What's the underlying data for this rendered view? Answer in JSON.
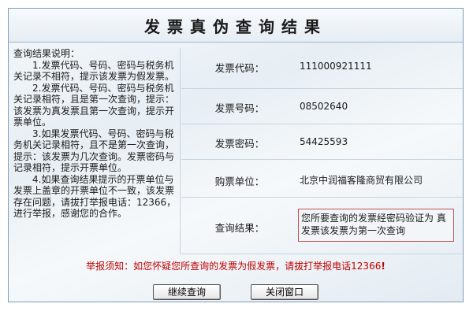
{
  "title": "发票真伪查询结果",
  "notes": {
    "heading": "查询结果说明：",
    "items": [
      "1.发票代码、号码、密码与税务机关记录不相符，提示该发票为假发票。",
      "2.发票代码、号码、密码与税务机关记录相符，且是第一次查询，提示：该发票为真发票且第一次查询，提示开票单位。",
      "3.如果发票代码、号码、密码与税务机关记录相符，且不是第一次查询，提示：该发票为几次查询。发票密码与记录相符，提示开票单位。",
      "4.如果查询结果提示的开票单位与发票上盖章的开票单位不一致，该发票存在问题，请拔打举报电话：12366，进行举报，感谢您的合作。"
    ]
  },
  "fields": {
    "code": {
      "label": "发票代码：",
      "value": "111000921111"
    },
    "number": {
      "label": "发票号码：",
      "value": "08502640"
    },
    "password": {
      "label": "发票密码：",
      "value": "54425593"
    },
    "buyer": {
      "label": "购票单位：",
      "value": "北京中润福客隆商贸有限公司"
    },
    "result": {
      "label": "查询结果：",
      "value": "您所要查询的发票经密码验证为 真发票该发票为第一次查询"
    }
  },
  "warning": {
    "text": "举报须知：如您怀疑您所查询的发票为假发票，请拔打举报电话12366",
    "mark": "!"
  },
  "buttons": {
    "continue": "继续查询",
    "close": "关闭窗口"
  },
  "colors": {
    "border": "#7f9db9",
    "warning": "#c00000",
    "result_border": "#c0504d"
  }
}
